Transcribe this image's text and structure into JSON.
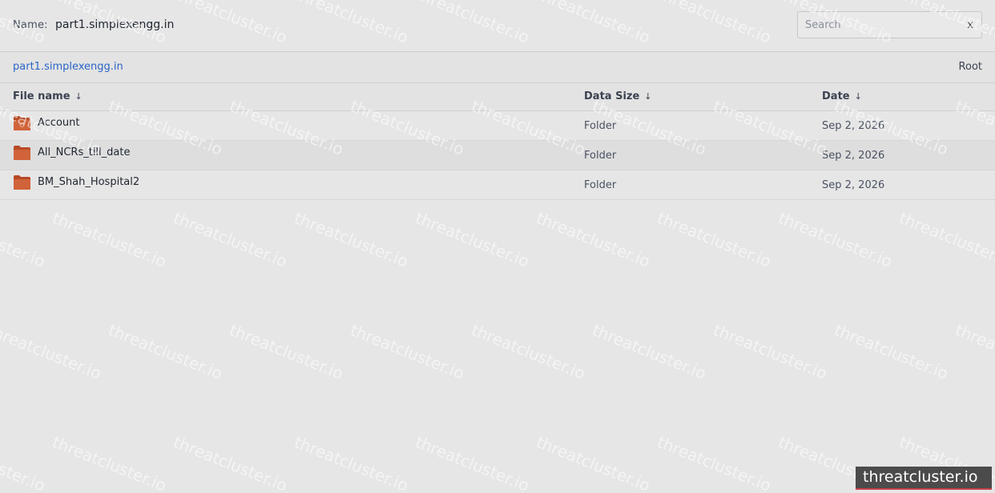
{
  "header": {
    "name_label": "Name:",
    "name_value": "part1.simplexengg.in"
  },
  "search": {
    "placeholder": "Search",
    "value": "",
    "clear_label": "x"
  },
  "breadcrumb": {
    "path_label": "part1.simplexengg.in",
    "root_label": "Root"
  },
  "table": {
    "columns": [
      {
        "label": "File name",
        "sort": "↓"
      },
      {
        "label": "Data Size",
        "sort": "↓"
      },
      {
        "label": "Date",
        "sort": "↓"
      }
    ],
    "rows": [
      {
        "name": "Account",
        "size": "Folder",
        "date": "Sep 2, 2026",
        "icon": "folder-icon"
      },
      {
        "name": "All_NCRs_till_date",
        "size": "Folder",
        "date": "Sep 2, 2026",
        "icon": "folder-icon"
      },
      {
        "name": "BM_Shah_Hospital2",
        "size": "Folder",
        "date": "Sep 2, 2026",
        "icon": "folder-icon"
      }
    ]
  },
  "watermark": {
    "text": "threatcluster.io",
    "brand_label": "threatcluster.io"
  },
  "colors": {
    "background": "#e6e6e6",
    "link": "#2b64c8",
    "folder": "#c8562e",
    "brand_bg": "#4b4b4b",
    "brand_accent": "#c8414b"
  }
}
